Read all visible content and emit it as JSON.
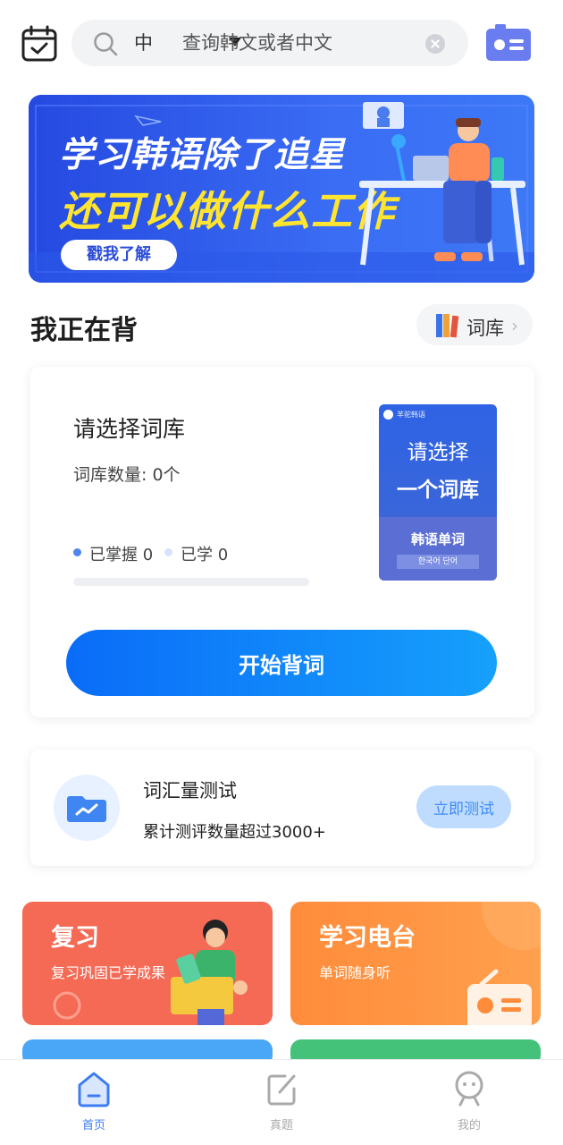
{
  "search": {
    "lang_label": "中",
    "placeholder": "查询韩文或者中文"
  },
  "banner": {
    "line1": "学习韩语除了追星",
    "line2": "还可以做什么工作",
    "cta": "戳我了解"
  },
  "section": {
    "title": "我正在背",
    "library_button": "词库"
  },
  "learn_card": {
    "choose_title": "请选择词库",
    "count_label": "词库数量: 0个",
    "mastered_label": "已掌握 0",
    "learned_label": "已学 0",
    "progress": 0,
    "book": {
      "brand": "羊驼韩语",
      "title_line1": "请选择",
      "title_line2": "一个词库",
      "subtitle": "韩语单词",
      "korean": "한국어 단어"
    },
    "start_button": "开始背词"
  },
  "vocab_test": {
    "title": "词汇量测试",
    "description": "累计测评数量超过3000+",
    "button": "立即测试"
  },
  "tiles": [
    {
      "title": "复习",
      "subtitle": "复习巩固已学成果"
    },
    {
      "title": "学习电台",
      "subtitle": "单词随身听"
    }
  ],
  "nav": [
    {
      "label": "首页"
    },
    {
      "label": "真题"
    },
    {
      "label": "我的"
    }
  ],
  "colors": {
    "accent": "#0a6cf8",
    "review_tile": "#f46a55",
    "radio_tile": "#ff8c3b",
    "nav_active": "#3c7cf2",
    "nav_inactive": "#aaaaaa"
  },
  "icons": [
    "calendar-check-icon",
    "search-icon",
    "caret-down-icon",
    "clear-icon",
    "id-card-icon",
    "books-icon",
    "chevron-right-icon",
    "folder-chart-icon",
    "home-icon",
    "edit-icon",
    "profile-icon",
    "radio-icon"
  ]
}
